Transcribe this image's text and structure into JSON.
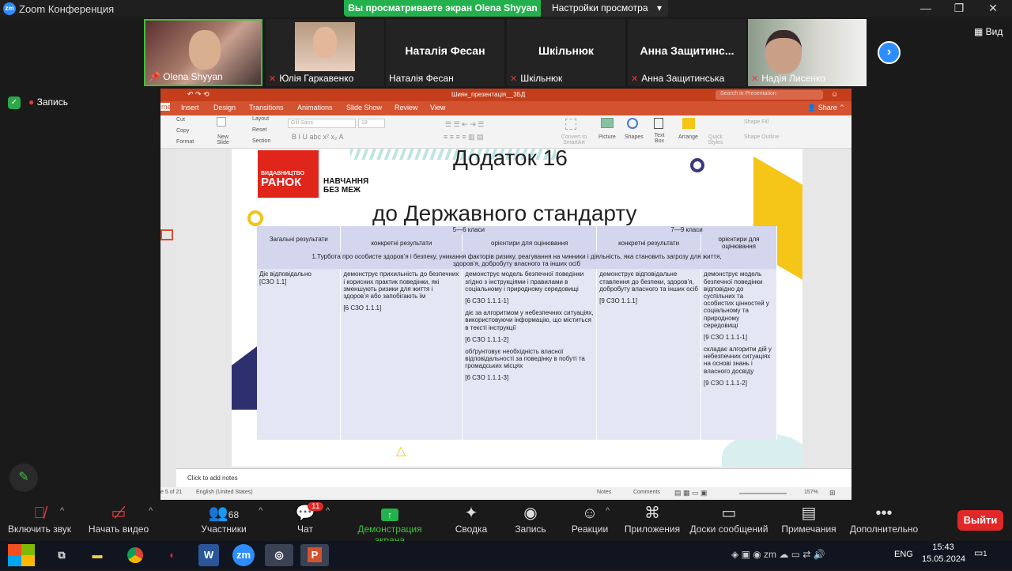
{
  "window": {
    "title": "Zoom Конференция",
    "zm": "zm"
  },
  "share_banner": {
    "viewing": "Вы просматриваете экран Olena Shyyan",
    "settings": "Настройки просмотра",
    "chevron": "▾"
  },
  "view_button": "Вид",
  "participants": [
    {
      "name": "Olena Shyyan",
      "muted": false
    },
    {
      "name": "Юлія Гаркавенко",
      "muted": true
    },
    {
      "name": "Наталія Фесан",
      "display": "Наталія Фесан",
      "muted": false
    },
    {
      "name": "Шкільнюк",
      "display": "Шкільнюк",
      "muted": true
    },
    {
      "name": "Анна Защитинська",
      "display": "Анна  Защитинс...",
      "muted": true
    },
    {
      "name": "Надія Лисенко",
      "muted": true
    }
  ],
  "recording": "Запись",
  "ppt": {
    "file": "Шиян_презентація__3БД",
    "search_placeholder": "Search in Presentation",
    "share": "Share",
    "tabs": [
      "me",
      "Insert",
      "Design",
      "Transitions",
      "Animations",
      "Slide Show",
      "Review",
      "View"
    ],
    "ribbon": {
      "cut": "Cut",
      "copy": "Copy",
      "format": "Format",
      "new_slide": "New Slide",
      "layout": "Layout",
      "reset": "Reset",
      "section": "Section",
      "font": "Gill Sans",
      "size": "18",
      "convert": "Convert to SmartArt",
      "picture": "Picture",
      "shapes": "Shapes",
      "textbox": "Text Box",
      "arrange": "Arrange",
      "quick_styles": "Quick Styles",
      "shape_fill": "Shape Fill",
      "shape_outline": "Shape Outline"
    },
    "notes": "Click to add notes",
    "status": {
      "slide": "e 5 of 21",
      "lang": "English (United States)",
      "notes": "Notes",
      "comments": "Comments",
      "zoom": "157%"
    }
  },
  "slide": {
    "title": "Додаток 16",
    "subtitle": "до Державного стандарту",
    "logo_top": "ВИДАВНИЦТВО",
    "logo_main": "РАНОК",
    "logo_tag": "НАВЧАННЯ БЕЗ МЕЖ",
    "table": {
      "h_general": "Загальні результати",
      "h_56": "5—6 класи",
      "h_79": "7—9 класи",
      "h_concrete": "конкретні результати",
      "h_orient": "орієнтири для оцінювання",
      "h_concrete2": "конкретні результати",
      "h_orient2": "орієнтири для оцінювання",
      "section": "1.Турбота про особисте здоров’я і безпеку, уникання факторів ризику, реагування на чинники і діяльність, яка становить загрозу для життя, здоров’я, добробуту власного та інших осіб",
      "c1a": "Діє  відповідально",
      "c1b": "[СЗО 1.1]",
      "c2a": "демонструє прихильність до безпечних і корисних практик поведінки, які зменшують ризики для життя і здоров’я або запобігають їм",
      "c2b": "[6 СЗО 1.1.1]",
      "c3a": "демонструє модель безпечної поведінки згідно  з інструкціями і правилами в соціальному і природному середовищі",
      "c3b": "[6 СЗО 1.1.1-1]",
      "c3c": "діє за алгоритмом у небезпечних ситуаціях, використовуючи інформацію, що міститься в тексті інструкції",
      "c3d": "[6 СЗО 1.1.1-2]",
      "c3e": "обґрунтовує необхідність власної відповідальності за поведінку в побуті та  громадських місцях",
      "c3f": "[6 СЗО 1.1.1-3]",
      "c4a": "демонструє відповідальне ставлення до безпеки, здоров’я, добробуту власного та інших осіб",
      "c4b": "[9 СЗО 1.1.1]",
      "c5a": "демонструє модель безпечної поведінки відповідно до суспільних та особистих цінностей у соціальному та природному середовищі",
      "c5b": "[9 СЗО 1.1.1-1]",
      "c5c": "складає алгоритм дій у небезпечних ситуаціях на основі знань і власного досвіду",
      "c5d": "[9 СЗО 1.1.1-2]"
    }
  },
  "toolbar": [
    {
      "label": "Включить звук",
      "icon": "mic-off-icon"
    },
    {
      "label": "Начать видео",
      "icon": "video-off-icon"
    },
    {
      "label": "Участники",
      "icon": "participants-icon",
      "count": "68"
    },
    {
      "label": "Чат",
      "icon": "chat-icon",
      "badge": "11"
    },
    {
      "label": "Демонстрация экрана",
      "icon": "share-screen-icon"
    },
    {
      "label": "Сводка",
      "icon": "summary-icon"
    },
    {
      "label": "Запись",
      "icon": "record-icon"
    },
    {
      "label": "Реакции",
      "icon": "reactions-icon"
    },
    {
      "label": "Приложения",
      "icon": "apps-icon"
    },
    {
      "label": "Доски сообщений",
      "icon": "whiteboard-icon"
    },
    {
      "label": "Примечания",
      "icon": "notes-icon"
    },
    {
      "label": "Дополнительно",
      "icon": "more-icon"
    }
  ],
  "leave": "Выйти",
  "taskbar": {
    "lang": "ENG",
    "time": "15:43",
    "date": "15.05.2024",
    "notif": "1"
  },
  "colors": {
    "zoom_green": "#23b14d",
    "ppt_orange": "#d35230",
    "leave_red": "#e02828",
    "zoom_blue": "#2d8cff"
  }
}
